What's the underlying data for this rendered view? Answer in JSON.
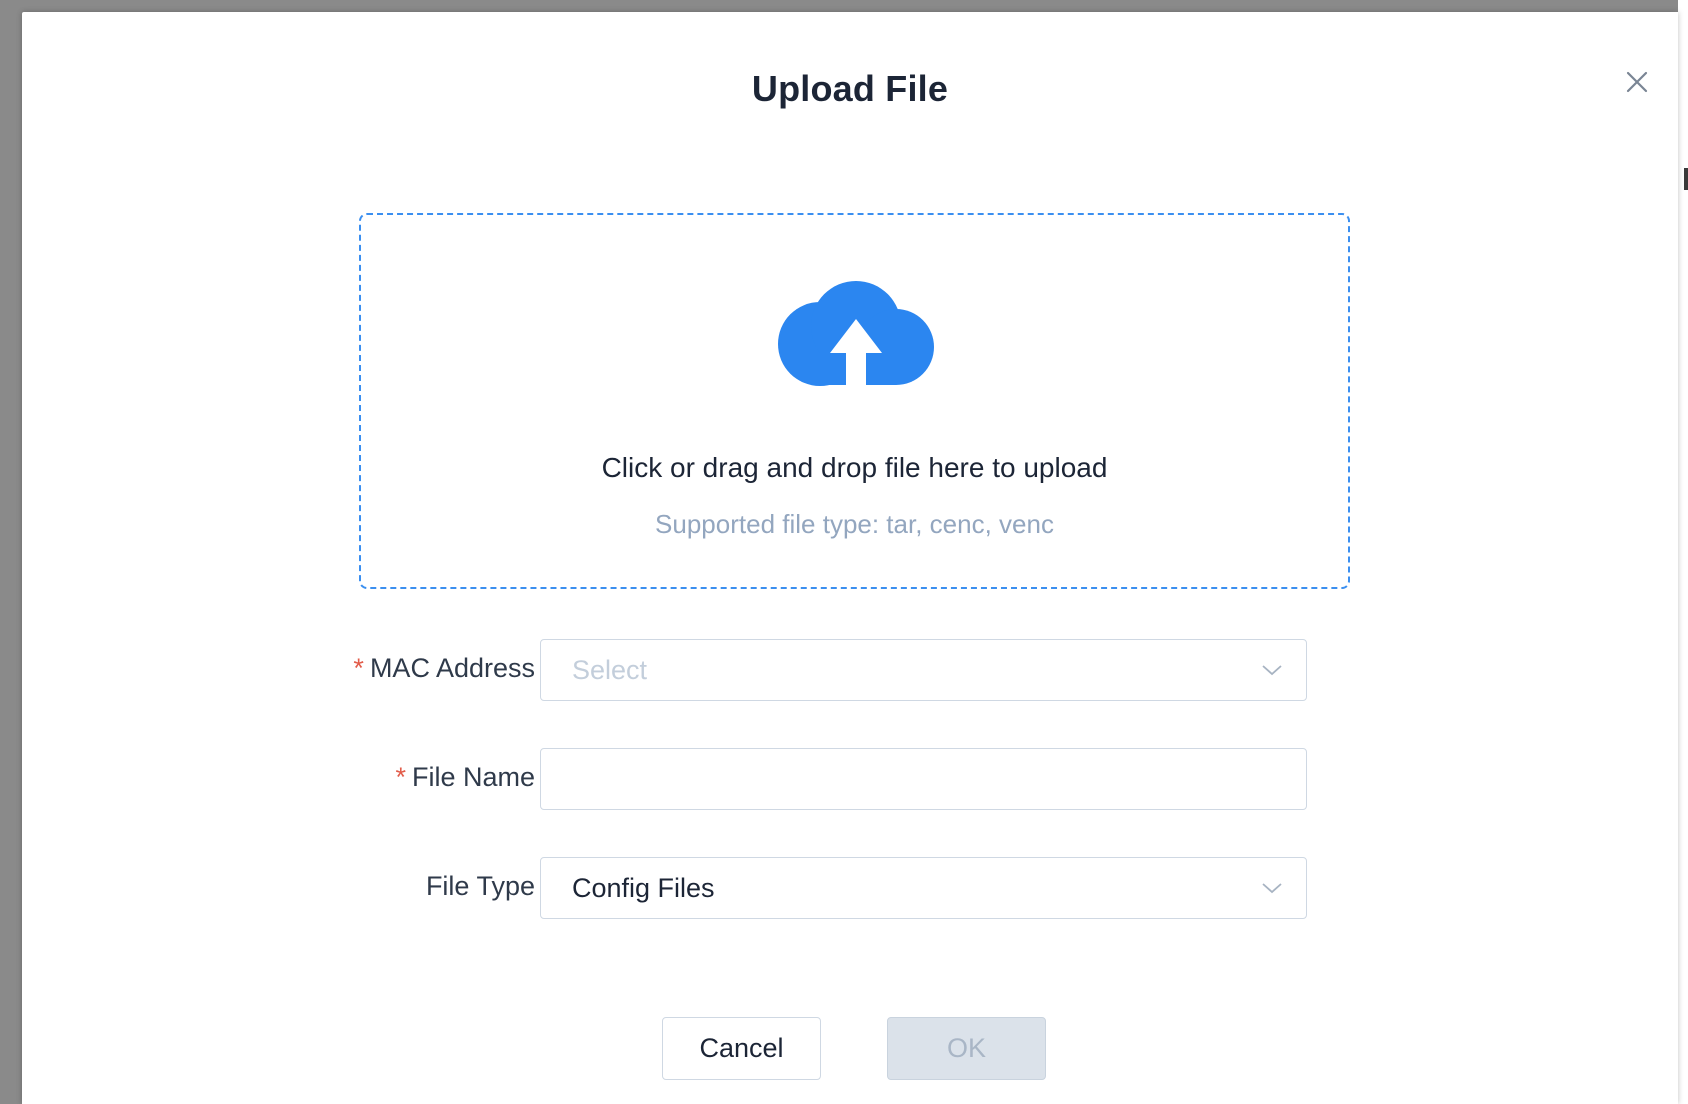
{
  "modal": {
    "title": "Upload File",
    "close_icon": "close-icon"
  },
  "dropzone": {
    "icon": "cloud-upload-icon",
    "icon_color": "#2b86f0",
    "title": "Click or drag and drop file here to upload",
    "subtitle": "Supported file type: tar, cenc, venc"
  },
  "form": {
    "required_marker": "*",
    "mac_address": {
      "label": "MAC Address",
      "required": true,
      "placeholder": "Select",
      "value": ""
    },
    "file_name": {
      "label": "File Name",
      "required": true,
      "value": ""
    },
    "file_type": {
      "label": "File Type",
      "required": false,
      "value": "Config Files"
    }
  },
  "buttons": {
    "cancel": "Cancel",
    "ok": "OK"
  },
  "colors": {
    "accent": "#2b86f0",
    "required": "#e25c4a",
    "disabled_button": "#dbe2ea"
  }
}
